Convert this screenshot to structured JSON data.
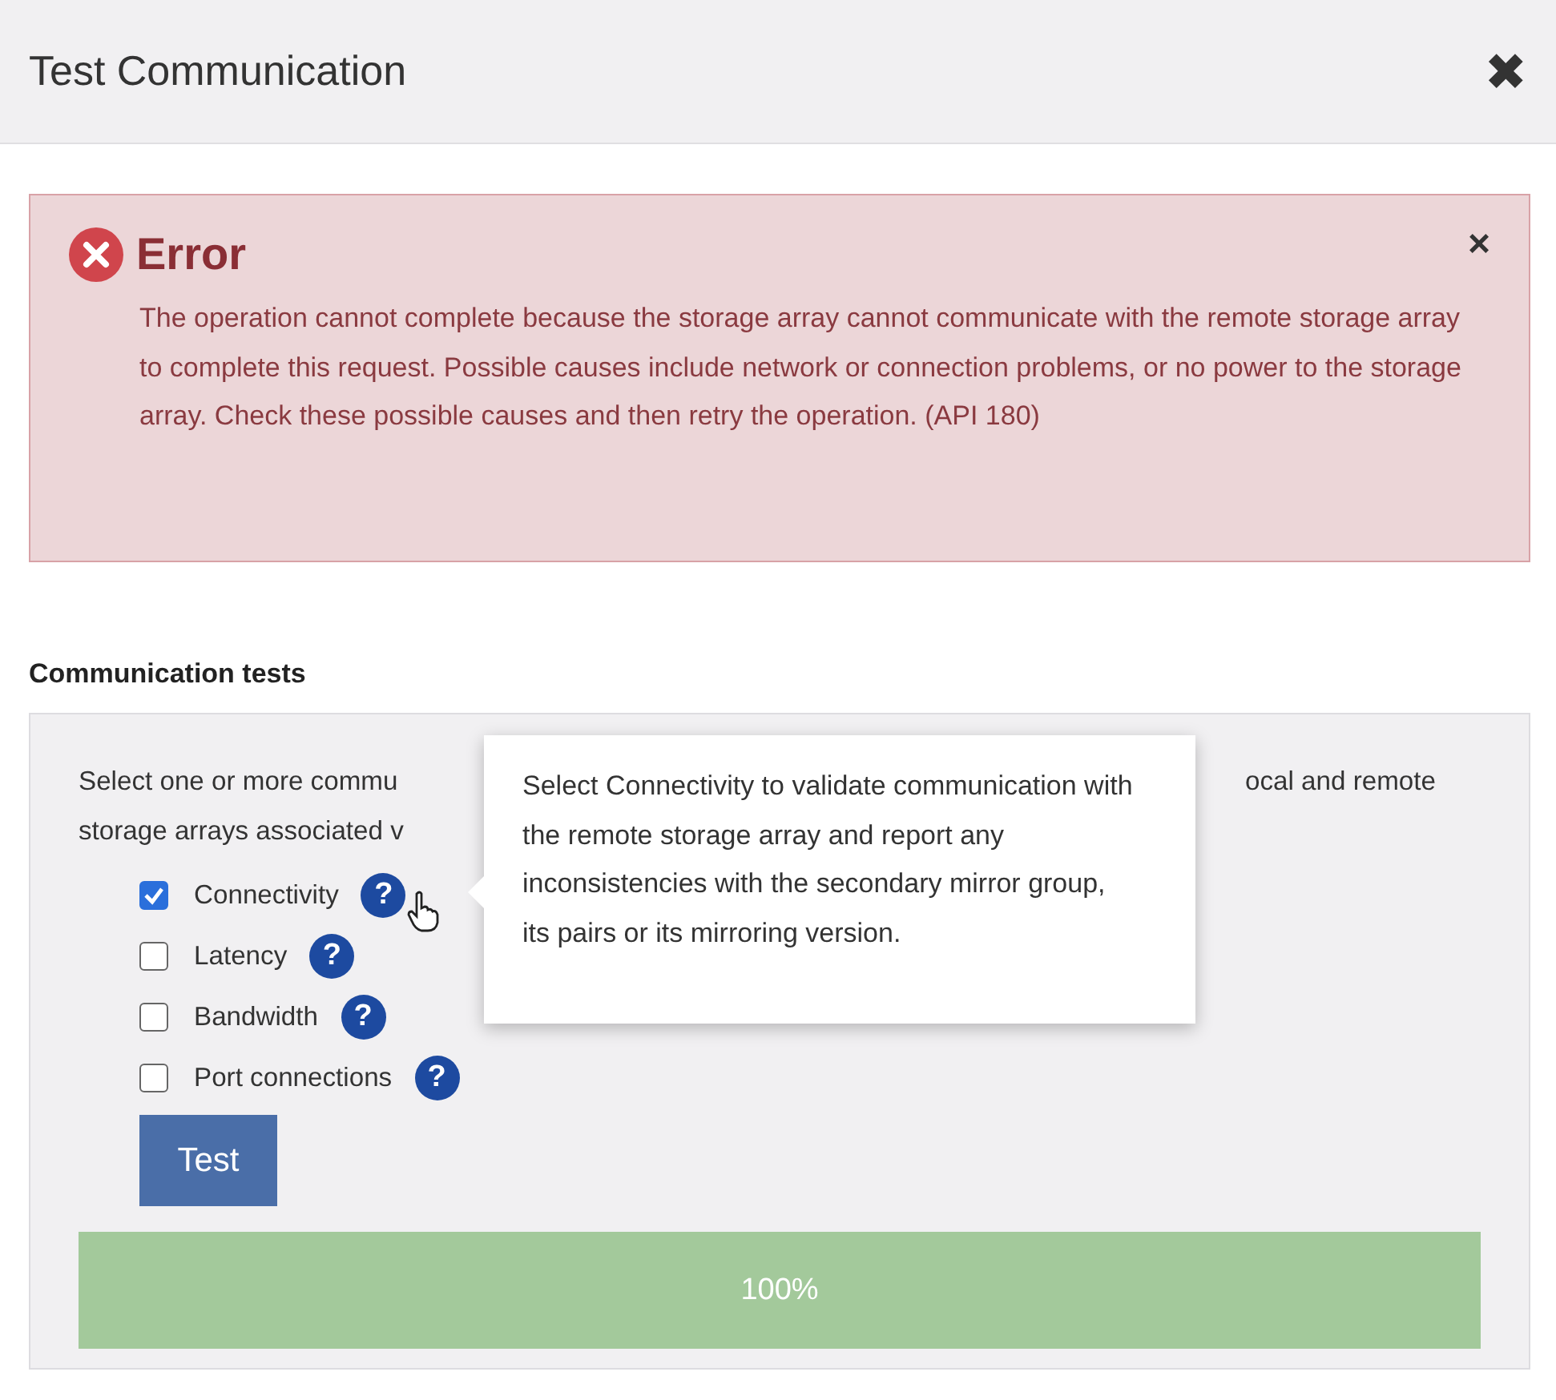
{
  "dialog": {
    "title": "Test Communication",
    "close": "✖"
  },
  "error": {
    "title": "Error",
    "close": "×",
    "message": "The operation cannot complete because the storage array cannot communicate with the remote storage array to complete this request. Possible causes include network or connection problems, or no power to the storage array. Check these possible causes and then retry the operation. (API 180)"
  },
  "section": {
    "heading": "Communication tests",
    "intro": [
      {
        "left": "Select one or more commu",
        "right": "ocal and remote"
      },
      {
        "left": "storage arrays associated v"
      }
    ],
    "tests": [
      {
        "label": "Connectivity",
        "checked": true,
        "help": "?"
      },
      {
        "label": "Latency",
        "checked": false,
        "help": "?"
      },
      {
        "label": "Bandwidth",
        "checked": false,
        "help": "?"
      },
      {
        "label": "Port connections",
        "checked": false,
        "help": "?"
      }
    ],
    "tooltip": "Select Connectivity to validate communication with the remote storage array and report any inconsistencies with the secondary mirror group, its pairs or its mirroring version.",
    "button": "Test",
    "progress": {
      "level": 1,
      "reading": "100%"
    }
  }
}
